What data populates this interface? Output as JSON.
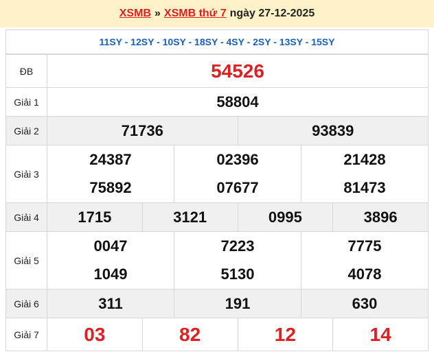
{
  "header": {
    "link1": "XSMB",
    "sep": "»",
    "link2": "XSMB thứ 7",
    "date": "ngày 27-12-2025"
  },
  "codes": "11SY - 12SY - 10SY - 18SY - 4SY - 2SY - 13SY - 15SY",
  "prizes": {
    "db": {
      "label": "ĐB",
      "values": [
        "54526"
      ]
    },
    "g1": {
      "label": "Giải 1",
      "values": [
        "58804"
      ]
    },
    "g2": {
      "label": "Giải 2",
      "values": [
        "71736",
        "93839"
      ]
    },
    "g3": {
      "label": "Giải 3",
      "values": [
        "24387",
        "02396",
        "21428",
        "75892",
        "07677",
        "81473"
      ]
    },
    "g4": {
      "label": "Giải 4",
      "values": [
        "1715",
        "3121",
        "0995",
        "3896"
      ]
    },
    "g5": {
      "label": "Giải 5",
      "values": [
        "0047",
        "7223",
        "7775",
        "1049",
        "5130",
        "4078"
      ]
    },
    "g6": {
      "label": "Giải 6",
      "values": [
        "311",
        "191",
        "630"
      ]
    },
    "g7": {
      "label": "Giải 7",
      "values": [
        "03",
        "82",
        "12",
        "14"
      ]
    }
  },
  "colors": {
    "accent": "#e02020",
    "codes": "#1560bd",
    "header_bg": "#fff2c8"
  }
}
